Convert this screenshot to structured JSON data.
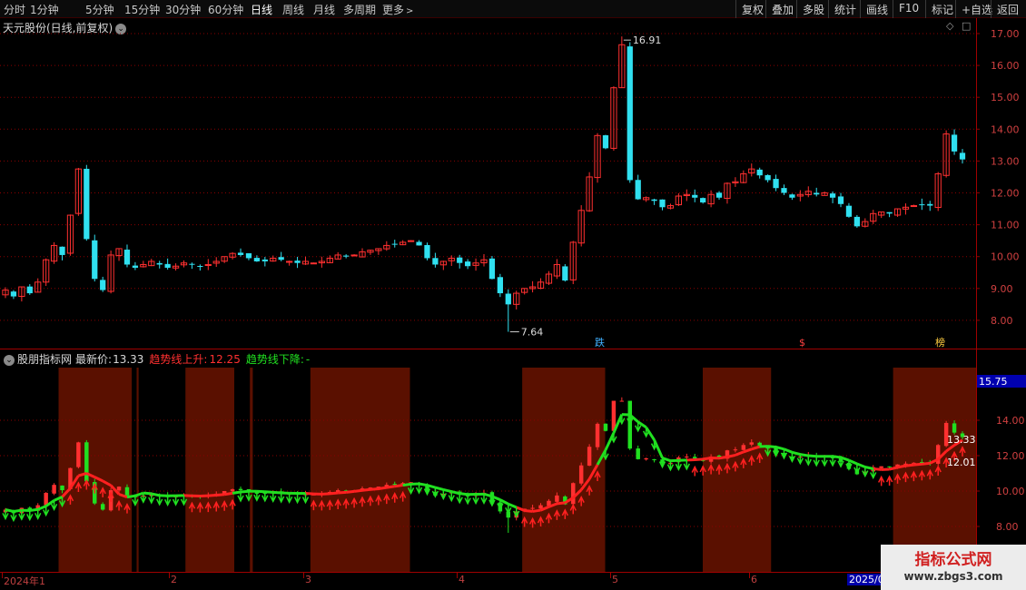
{
  "toolbar": {
    "periods": [
      "分时",
      "1分钟",
      "5分钟",
      "15分钟",
      "30分钟",
      "60分钟",
      "日线",
      "周线",
      "月线",
      "多周期",
      "更多"
    ],
    "active_period": "日线",
    "right_buttons": [
      "复权",
      "叠加",
      "多股",
      "统计",
      "画线",
      "F10",
      "标记",
      "+自选",
      "返回"
    ]
  },
  "main_chart": {
    "title": "天元股份(日线,前复权)",
    "high_label": "16.91",
    "low_label": "7.64",
    "event_markers": [
      "跌",
      "$",
      "榜"
    ],
    "price_axis_ticks": [
      "17.00",
      "16.00",
      "15.00",
      "14.00",
      "13.00",
      "12.00",
      "11.00",
      "10.00",
      "9.00",
      "8.00"
    ]
  },
  "indicator": {
    "name": "股朋指标网",
    "latest_price_label": "最新价:",
    "latest_price": "13.33",
    "trend_up_label": "趋势线上升:",
    "trend_up_value": "12.25",
    "trend_down_label": "趋势线下降:",
    "trend_down_value": "-",
    "axis_ticks": [
      "15.75",
      "14.00",
      "12.00",
      "10.00",
      "8.00"
    ],
    "highlighted_tick": "15.75",
    "price_tag": "13.33",
    "trend_tag": "12.01"
  },
  "date_axis": {
    "labels": [
      "2024年1",
      "2",
      "3",
      "4",
      "5",
      "6",
      "2025/0"
    ]
  },
  "watermark": {
    "title": "指标公式网",
    "url": "www.zbgs3.com"
  },
  "colors": {
    "up": "#ff3030",
    "down": "#30e0f0",
    "trend_up": "#ff2020",
    "trend_down": "#20e020",
    "zone": "#5a1000",
    "grid": "#8a0000",
    "axis_text": "#d04040"
  },
  "chart_data": [
    {
      "type": "candlestick",
      "title": "天元股份(日线,前复权)",
      "ylim": [
        7.5,
        17.3
      ],
      "annotations": [
        {
          "text": "16.91",
          "value": 16.91,
          "kind": "period-high"
        },
        {
          "text": "7.64",
          "value": 7.64,
          "kind": "period-low"
        }
      ],
      "closes": [
        8.95,
        8.75,
        9.05,
        8.85,
        9.2,
        9.9,
        10.35,
        10.05,
        11.3,
        12.75,
        10.55,
        9.3,
        8.95,
        10.05,
        10.25,
        9.75,
        9.65,
        9.75,
        9.85,
        9.75,
        9.65,
        9.7,
        9.8,
        9.75,
        9.7,
        9.75,
        9.85,
        10.0,
        10.1,
        10.05,
        9.95,
        9.85,
        9.85,
        9.95,
        9.9,
        9.85,
        9.8,
        9.85,
        9.8,
        9.85,
        9.95,
        10.05,
        10.0,
        10.05,
        10.15,
        10.2,
        10.25,
        10.35,
        10.4,
        10.45,
        10.5,
        10.35,
        9.95,
        9.75,
        9.85,
        9.95,
        9.8,
        9.7,
        9.8,
        9.9,
        9.3,
        8.85,
        8.5,
        8.85,
        9.0,
        9.05,
        9.2,
        9.45,
        9.75,
        9.25,
        10.45,
        11.45,
        12.5,
        13.8,
        13.4,
        15.3,
        16.65,
        12.4,
        11.8,
        11.85,
        11.75,
        11.55,
        11.6,
        11.9,
        11.95,
        11.85,
        11.7,
        11.95,
        11.85,
        12.3,
        12.35,
        12.6,
        12.75,
        12.55,
        12.4,
        12.15,
        12.0,
        11.85,
        11.95,
        12.05,
        11.95,
        12.0,
        11.85,
        11.65,
        11.25,
        10.95,
        11.1,
        11.35,
        11.4,
        11.35,
        11.5,
        11.55,
        11.6,
        11.62,
        11.6,
        12.6,
        13.85,
        13.3,
        13.05
      ],
      "trend_state": "down-up-down-up-down-up-down-up-down-up-down-up"
    }
  ]
}
